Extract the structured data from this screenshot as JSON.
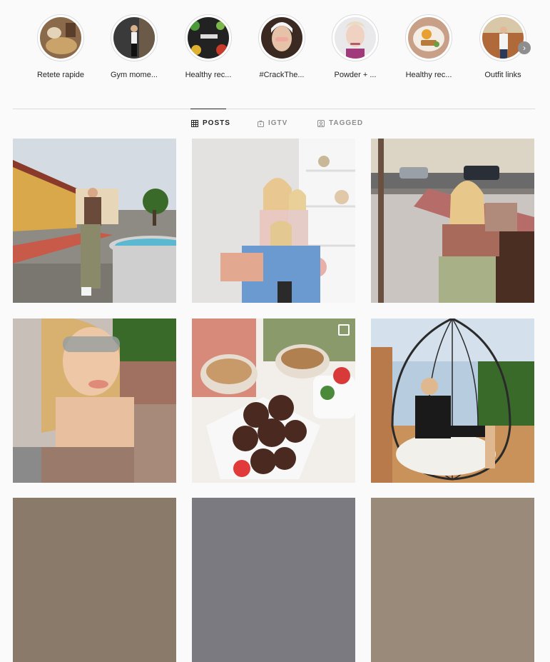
{
  "highlights": [
    {
      "label": "Retete rapide"
    },
    {
      "label": "Gym mome..."
    },
    {
      "label": "Healthy rec..."
    },
    {
      "label": "#CrackThe..."
    },
    {
      "label": "Powder + ..."
    },
    {
      "label": "Healthy rec..."
    },
    {
      "label": "Outfit links"
    }
  ],
  "tabs": [
    {
      "label": "POSTS",
      "icon": "grid-icon",
      "active": true
    },
    {
      "label": "IGTV",
      "icon": "igtv-icon",
      "active": false
    },
    {
      "label": "TAGGED",
      "icon": "tagged-icon",
      "active": false
    }
  ],
  "posts": [
    {
      "description": "street-selfie"
    },
    {
      "description": "family-photo"
    },
    {
      "description": "bench-photo"
    },
    {
      "description": "closeup-selfie"
    },
    {
      "description": "cookies-plate",
      "multiple": true
    },
    {
      "description": "hanging-chair"
    }
  ],
  "colors": {
    "divider": "#dbdbdb",
    "text": "#262626",
    "muted": "#8e8e8e"
  }
}
